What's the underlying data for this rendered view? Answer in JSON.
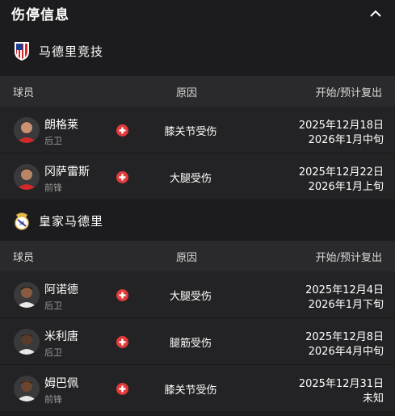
{
  "header": {
    "title": "伤停信息"
  },
  "columns": {
    "player": "球员",
    "reason": "原因",
    "return": "开始/预计复出"
  },
  "teams": [
    {
      "name": "马德里竞技",
      "logo": "atletico-madrid-logo",
      "players": [
        {
          "name": "朗格莱",
          "position": "后卫",
          "reason": "膝关节受伤",
          "start": "2025年12月18日",
          "return": "2026年1月中旬"
        },
        {
          "name": "冈萨雷斯",
          "position": "前锋",
          "reason": "大腿受伤",
          "start": "2025年12月22日",
          "return": "2026年1月上旬"
        }
      ]
    },
    {
      "name": "皇家马德里",
      "logo": "real-madrid-logo",
      "players": [
        {
          "name": "阿诺德",
          "position": "后卫",
          "reason": "大腿受伤",
          "start": "2025年12月4日",
          "return": "2026年1月下旬"
        },
        {
          "name": "米利唐",
          "position": "后卫",
          "reason": "腿筋受伤",
          "start": "2025年12月8日",
          "return": "2026年4月中旬"
        },
        {
          "name": "姆巴佩",
          "position": "前锋",
          "reason": "膝关节受伤",
          "start": "2025年12月31日",
          "return": "未知"
        }
      ]
    }
  ],
  "colors": {
    "injury_icon": "#e03b3b",
    "background": "#1c1c1e",
    "row": "#232325",
    "column_header": "#2a2a2c"
  }
}
